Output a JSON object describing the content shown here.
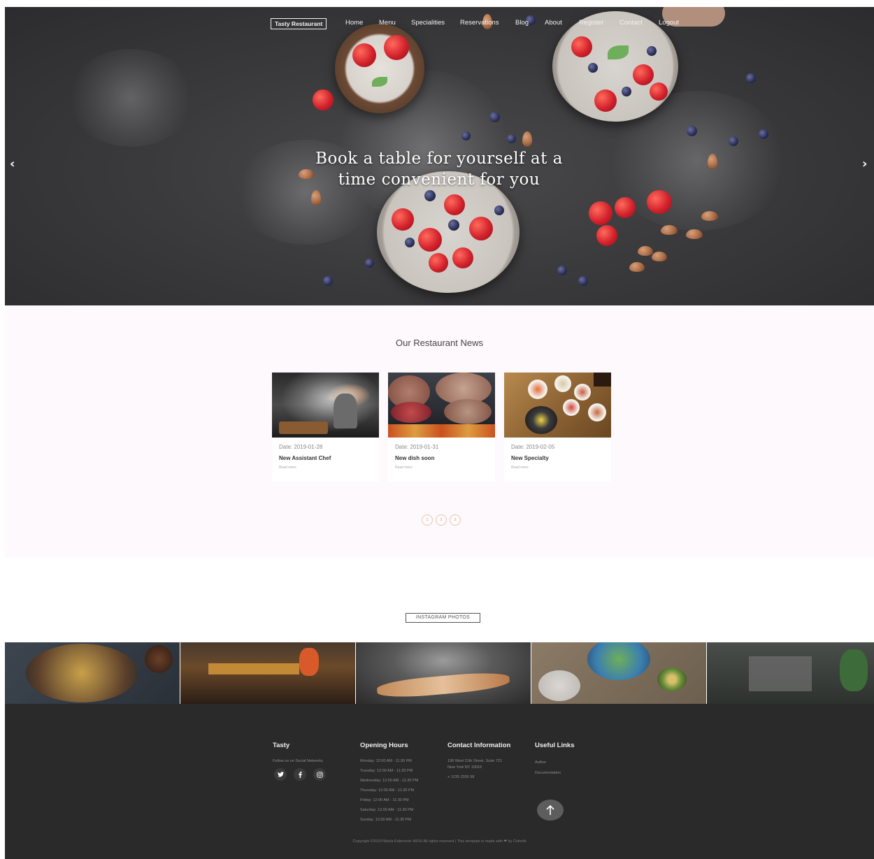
{
  "nav": {
    "brand": "Tasty Restaurant",
    "links": [
      "Home",
      "Menu",
      "Specialities",
      "Reservations",
      "Blog",
      "About",
      "Register",
      "Contact",
      "Logout"
    ]
  },
  "hero": {
    "title_line1": "Book a table for yourself at a",
    "title_line2": "time convenient for you",
    "prev_arrow": "‹",
    "next_arrow": "›"
  },
  "news": {
    "heading": "Our Restaurant News",
    "cards": [
      {
        "date": "Date: 2019-01-28",
        "title": "New Assistant Chef",
        "more": "Read more"
      },
      {
        "date": "Date: 2019-01-31",
        "title": "New dish soon",
        "more": "Read more"
      },
      {
        "date": "Date: 2019-02-05",
        "title": "New Specialty",
        "more": "Read more"
      }
    ],
    "pages": [
      "1",
      "2",
      "3"
    ]
  },
  "instagram": {
    "button": "INSTAGRAM PHOTOS"
  },
  "footer": {
    "tasty": {
      "heading": "Tasty",
      "follow": "Follow us on Social Networks"
    },
    "social_icons": [
      "twitter-icon",
      "facebook-icon",
      "instagram-icon"
    ],
    "hours": {
      "heading": "Opening Hours",
      "rows": [
        "Monday: 12:00 AM - 11:30 PM",
        "Tuesday: 12:00 AM - 11:30 PM",
        "Wednesday: 12:00 AM - 11:30 PM",
        "Thursday: 12:00 AM - 11:30 PM",
        "Friday: 12:00 AM - 11:30 PM",
        "Saturday: 12:00 AM - 11:30 PM",
        "Sunday: 12:00 AM - 11:30 PM"
      ]
    },
    "contact": {
      "heading": "Contact Information",
      "address1": "198 West 21th Street, Suite 721",
      "address2": "New York NY 10016",
      "phone": "+ 1235 2355 98"
    },
    "links": {
      "heading": "Useful Links",
      "items": [
        "Author",
        "Documentation"
      ]
    },
    "copyright": "Copyright ©2019 Nikola Kalinčević 40/16 All rights reserved | This template is made with ❤ by Colorlib"
  }
}
